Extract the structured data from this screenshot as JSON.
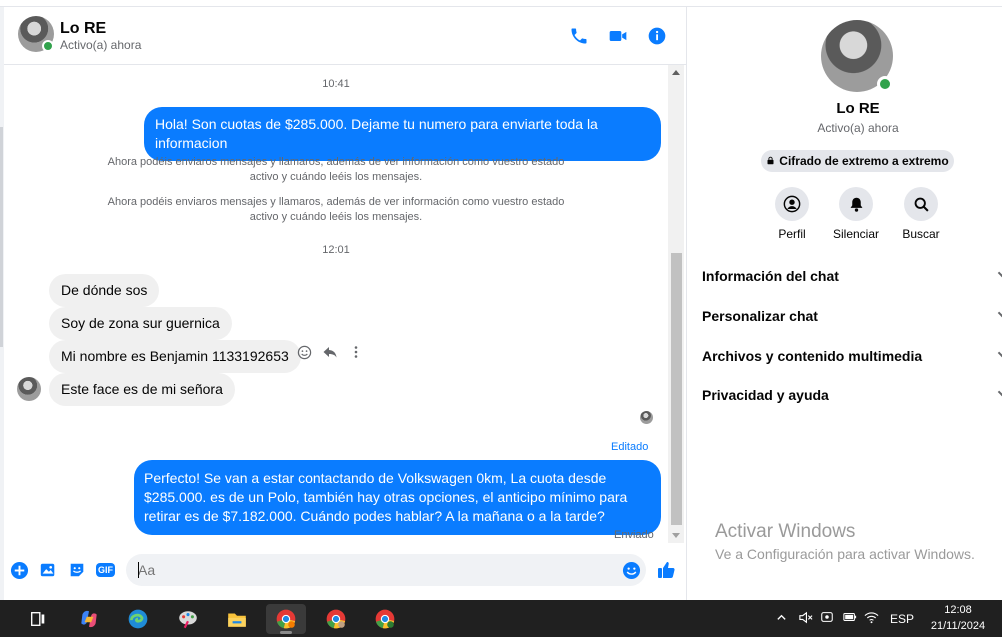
{
  "chat": {
    "contact_name": "Lo RE",
    "status": "Activo(a) ahora"
  },
  "messages": {
    "time1": "10:41",
    "out1": "Hola! Son cuotas de $285.000. Dejame tu numero para enviarte toda la informacion",
    "sys1": "Ahora podéis enviaros mensajes y llamaros, además de ver información como vuestro estado activo y cuándo leéis los mensajes.",
    "sys2": "Ahora podéis enviaros mensajes y llamaros, además de ver información como vuestro estado activo y cuándo leéis los mensajes.",
    "time2": "12:01",
    "in1": "De dónde sos",
    "in2": "Soy de zona sur guernica",
    "in3": "Mi nombre es Benjamin 1133192653",
    "in4": "Este face es de mi señora",
    "edited": "Editado",
    "out2": "Perfecto!  Se van a estar contactando de Volkswagen 0km, La cuota desde $285.000. es de un Polo, también hay otras opciones, el anticipo mínimo para retirar es de $7.182.000. Cuándo podes hablar? A la mañana o a la tarde?",
    "sent": "Enviado"
  },
  "composer": {
    "placeholder": "Aa",
    "gif_label": "GIF"
  },
  "panel": {
    "name": "Lo RE",
    "status": "Activo(a) ahora",
    "e2e_label": "Cifrado de extremo a extremo",
    "actions": [
      "Perfil",
      "Silenciar",
      "Buscar"
    ],
    "sections": [
      "Información del chat",
      "Personalizar chat",
      "Archivos y contenido multimedia",
      "Privacidad y ayuda"
    ]
  },
  "watermark": {
    "title": "Activar Windows",
    "subtitle": "Ve a Configuración para activar Windows."
  },
  "taskbar": {
    "lang": "ESP",
    "time": "12:08",
    "date": "21/11/2024"
  },
  "colors": {
    "accent": "#0a7cff",
    "online": "#31a24c"
  }
}
